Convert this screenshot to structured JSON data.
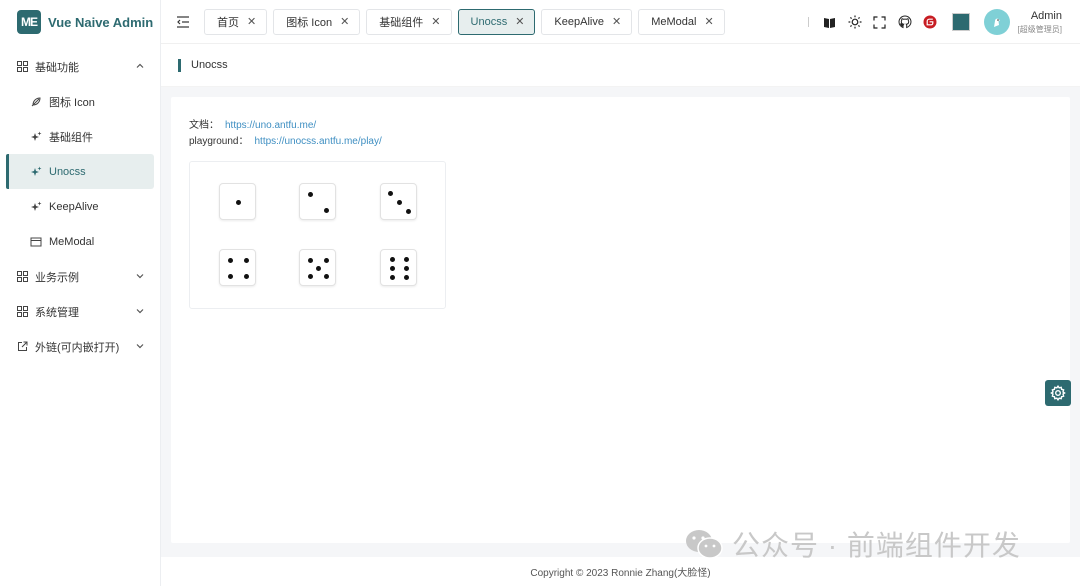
{
  "brand": {
    "logo_text": "ME",
    "title": "Vue Naive Admin"
  },
  "sidebar": {
    "items": [
      {
        "label": "基础功能",
        "icon": "grid-icon",
        "expanded": true
      },
      {
        "label": "图标 Icon",
        "icon": "feather-icon"
      },
      {
        "label": "基础组件",
        "icon": "sparkles-icon"
      },
      {
        "label": "Unocss",
        "icon": "sparkles-icon",
        "active": true
      },
      {
        "label": "KeepAlive",
        "icon": "sparkles-icon"
      },
      {
        "label": "MeModal",
        "icon": "window-icon"
      },
      {
        "label": "业务示例",
        "icon": "grid-icon"
      },
      {
        "label": "系统管理",
        "icon": "grid-icon"
      },
      {
        "label": "外链(可内嵌打开)",
        "icon": "external-link-icon"
      }
    ]
  },
  "tabs": [
    {
      "label": "首页"
    },
    {
      "label": "图标 Icon"
    },
    {
      "label": "基础组件"
    },
    {
      "label": "Unocss",
      "active": true
    },
    {
      "label": "KeepAlive"
    },
    {
      "label": "MeModal"
    }
  ],
  "tab_close_glyph": "✕",
  "user": {
    "name": "Admin",
    "role": "[超级管理员]"
  },
  "theme_color": "#2d6a70",
  "breadcrumb": {
    "title": "Unocss"
  },
  "content": {
    "docs_label": "文档：",
    "docs_link": "https://uno.antfu.me/",
    "playground_label": "playground：",
    "playground_link": "https://unocss.antfu.me/play/",
    "dice_faces": [
      1,
      2,
      3,
      4,
      5,
      6
    ]
  },
  "footer": {
    "copyright": "Copyright © 2023 Ronnie Zhang(大脸怪)"
  },
  "watermark": {
    "text": "公众号 · 前端组件开发"
  }
}
